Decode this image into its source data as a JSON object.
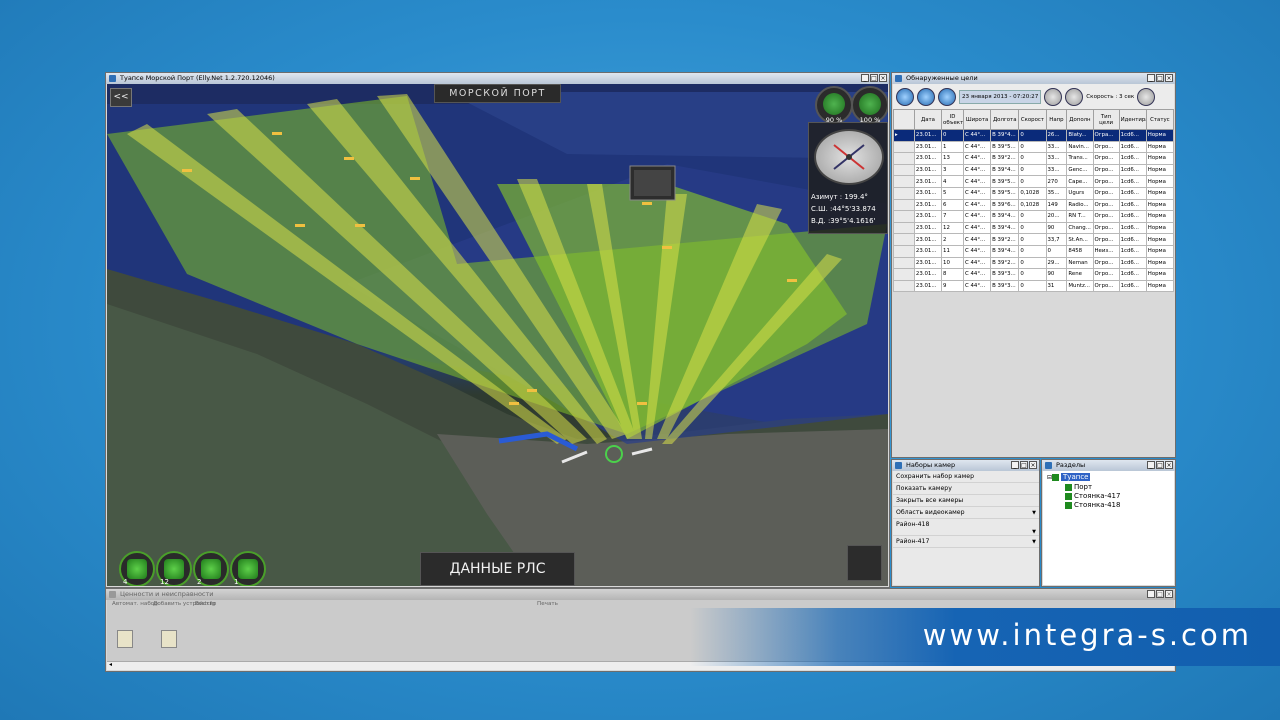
{
  "main_window": {
    "title": "Туапсе Морской Порт (Elly.Net 1.2.720.12046)",
    "collapse_label": "<<",
    "port_label": "МОРСКОЙ ПОРТ",
    "rls_label": "ДАННЫЕ РЛС",
    "gauges": [
      {
        "label": "90 %"
      },
      {
        "label": "100 %"
      }
    ],
    "compass": {
      "azimuth": "Азимут : 199.4°",
      "lat": "С.Ш. :44°5'33.874",
      "lon": "В.Д. :39°5'4.1616'"
    },
    "tools": [
      {
        "count": "4",
        "icon": "cube-icon"
      },
      {
        "count": "12",
        "icon": "camera-icon"
      },
      {
        "count": "2",
        "icon": "box-icon"
      },
      {
        "count": "1",
        "icon": "lock-icon"
      }
    ]
  },
  "targets_window": {
    "title": "Обнаруженные цели",
    "date": "23 января 2013 - 07:20:27",
    "speed": "Скорость : 3 сек",
    "columns": [
      "",
      "Дата",
      "ID объект",
      "Широта",
      "Долгота",
      "Скорост",
      "Напр",
      "Дополн",
      "Тип цели",
      "Идентирадара",
      "Статус"
    ],
    "rows": [
      [
        "▸",
        "23.01...",
        "0",
        "С 44°...",
        "В 39°4...",
        "0",
        "26...",
        "Blaty...",
        "Огра...",
        "1cd6...",
        "Норма"
      ],
      [
        "",
        "23.01...",
        "1",
        "С 44°...",
        "В 39°5...",
        "0",
        "33...",
        "Navin...",
        "Огро...",
        "1cd6...",
        "Норма"
      ],
      [
        "",
        "23.01...",
        "13",
        "С 44°...",
        "В 39°2...",
        "0",
        "33...",
        "Trans...",
        "Огро...",
        "1cd6...",
        "Норма"
      ],
      [
        "",
        "23.01...",
        "3",
        "С 44°...",
        "В 39°4...",
        "0",
        "33...",
        "Genc...",
        "Огро...",
        "1cd6...",
        "Норма"
      ],
      [
        "",
        "23.01...",
        "4",
        "С 44°...",
        "В 39°5...",
        "0",
        "270",
        "Cape...",
        "Огро...",
        "1cd6...",
        "Норма"
      ],
      [
        "",
        "23.01...",
        "5",
        "С 44°...",
        "В 39°5...",
        "0,1028",
        "35...",
        "Ugurs",
        "Огро...",
        "1cd6...",
        "Норма"
      ],
      [
        "",
        "23.01...",
        "6",
        "С 44°...",
        "В 39°6...",
        "0,1028",
        "149",
        "Radio...",
        "Огро...",
        "1cd6...",
        "Норма"
      ],
      [
        "",
        "23.01...",
        "7",
        "С 44°...",
        "В 39°4...",
        "0",
        "20...",
        "RN T...",
        "Огро...",
        "1cd6...",
        "Норма"
      ],
      [
        "",
        "23.01...",
        "12",
        "С 44°...",
        "В 39°4...",
        "0",
        "90",
        "Chang...",
        "Огро...",
        "1cd6...",
        "Норма"
      ],
      [
        "",
        "23.01...",
        "2",
        "С 44°...",
        "В 39°2...",
        "0",
        "33,7",
        "St.An...",
        "Огро...",
        "1cd6...",
        "Норма"
      ],
      [
        "",
        "23.01...",
        "11",
        "С 44°...",
        "В 39°4...",
        "0",
        "0",
        "8458",
        "Неиз...",
        "1cd6...",
        "Норма"
      ],
      [
        "",
        "23.01...",
        "10",
        "С 44°...",
        "В 39°2...",
        "0",
        "29...",
        "Neman",
        "Огро...",
        "1cd6...",
        "Норма"
      ],
      [
        "",
        "23.01...",
        "8",
        "С 44°...",
        "В 39°3...",
        "0",
        "90",
        "Rene",
        "Огро...",
        "1cd6...",
        "Норма"
      ],
      [
        "",
        "23.01...",
        "9",
        "С 44°...",
        "В 39°3...",
        "0",
        "31",
        "Muntz...",
        "Огро...",
        "1cd6...",
        "Норма"
      ]
    ]
  },
  "cameras_window": {
    "title": "Наборы камер",
    "items": [
      "Сохранить набор камер",
      "Показать камеру",
      "Закрыть все камеры",
      "Область видеокамер",
      "Район-418",
      "Район-417"
    ]
  },
  "sections_window": {
    "title": "Разделы",
    "root": "Туапсе",
    "children": [
      "Порт",
      "Стоянка-417",
      "Стоянка-418"
    ]
  },
  "devices_window": {
    "title": "Ценности и неисправности",
    "labels": [
      "Автомат. набор",
      "Добавить устройство",
      "Bratcfg",
      "Печать"
    ]
  },
  "watermark": {
    "url": "www.integra-s.com"
  }
}
